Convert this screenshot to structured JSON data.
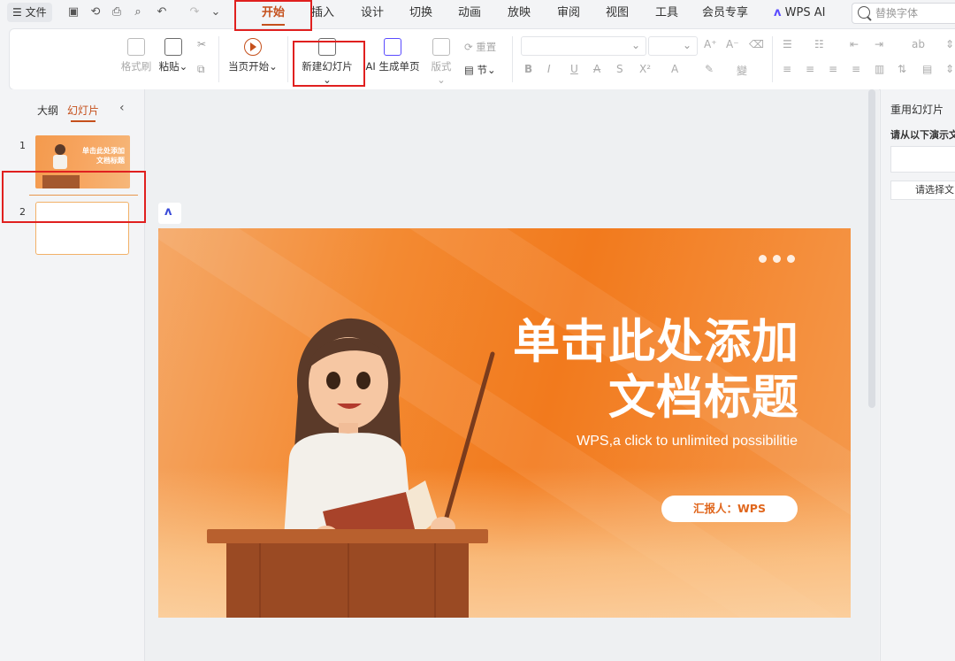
{
  "menu": {
    "file_label": "文件",
    "tabs": [
      "开始",
      "插入",
      "设计",
      "切换",
      "动画",
      "放映",
      "审阅",
      "视图",
      "工具",
      "会员专享",
      "WPS AI"
    ],
    "search_placeholder": "替换字体"
  },
  "ribbon": {
    "format_painter": "格式刷",
    "paste": "粘贴",
    "start_from_current": "当页开始",
    "new_slide": "新建幻灯片",
    "ai_generate": "AI 生成单页",
    "layout": "版式",
    "reset": "重置",
    "section": "节"
  },
  "left_panel": {
    "tab_outline": "大纲",
    "tab_slides": "幻灯片",
    "thumb1_num": "1",
    "thumb2_num": "2",
    "thumb1_title_l1": "单击此处添加",
    "thumb1_title_l2": "文档标题"
  },
  "slide": {
    "title_line1": "单击此处添加",
    "title_line2": "文档标题",
    "subtitle": "WPS,a click to unlimited possibilitie",
    "reporter": "汇报人：WPS"
  },
  "right_panel": {
    "title": "重用幻灯片",
    "prompt": "请从以下演示文",
    "button": "请选择文"
  },
  "colors": {
    "accent": "#c5501c",
    "slide_orange": "#f27a1d",
    "highlight_red": "#e0201f"
  }
}
